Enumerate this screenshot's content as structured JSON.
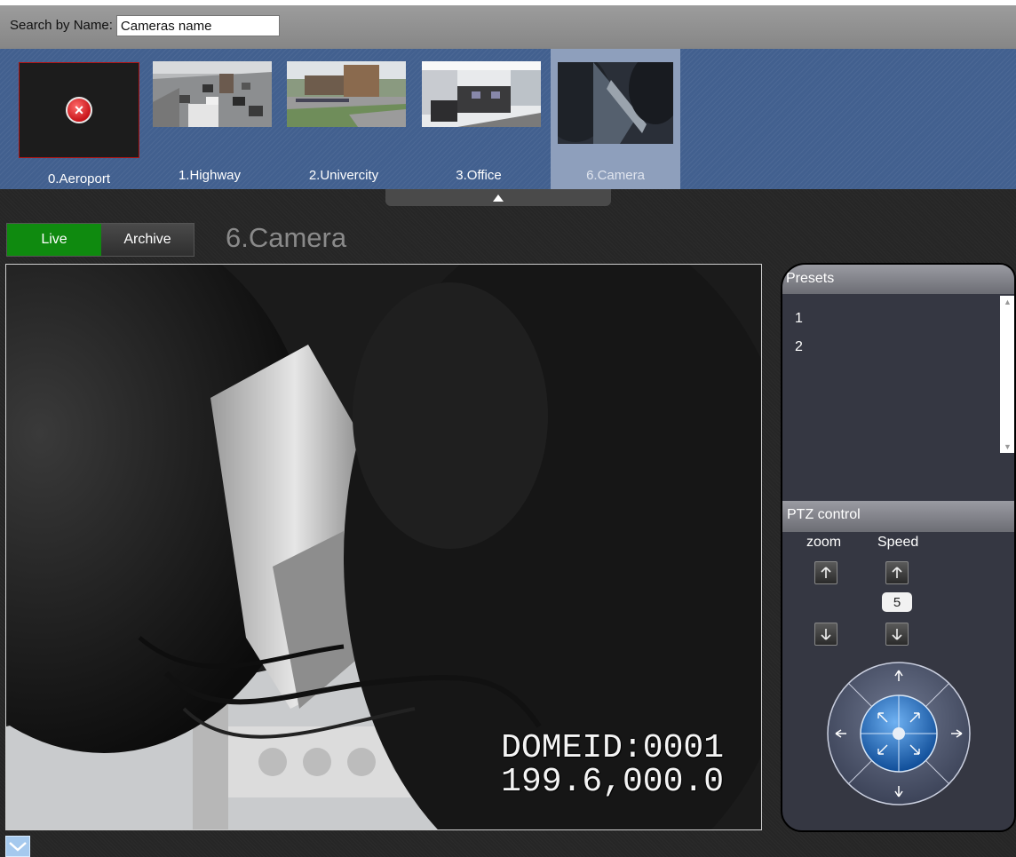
{
  "search": {
    "label": "Search by Name:",
    "value": "Cameras name"
  },
  "cameras": [
    {
      "label": "0.Aeroport",
      "status": "error"
    },
    {
      "label": "1.Highway",
      "status": "ok"
    },
    {
      "label": "2.Univercity",
      "status": "ok"
    },
    {
      "label": "3.Office",
      "status": "ok"
    },
    {
      "label": "6.Camera",
      "status": "selected"
    }
  ],
  "view_modes": {
    "live": "Live",
    "archive": "Archive",
    "active": "Live"
  },
  "current_camera": "6.Camera",
  "video": {
    "osd_line1": "DOMEID:0001",
    "osd_line2": "199.6,000.0"
  },
  "presets": {
    "title": "Presets",
    "items": [
      "1",
      "2"
    ]
  },
  "ptz": {
    "title": "PTZ control",
    "zoom_label": "zoom",
    "speed_label": "Speed",
    "speed_value": "5"
  },
  "colors": {
    "live_active": "#0f8a0f",
    "strip_bg": "#42608f",
    "selected_cam": "#8e9fbc",
    "panel_bg": "#353742",
    "title_gray": "#8a8a8a"
  },
  "icons": {
    "error": "error-x-icon",
    "collapse": "triangle-up-icon",
    "expand": "chevron-down-icon",
    "arrow_up": "arrow-up-icon",
    "arrow_down": "arrow-down-icon"
  }
}
